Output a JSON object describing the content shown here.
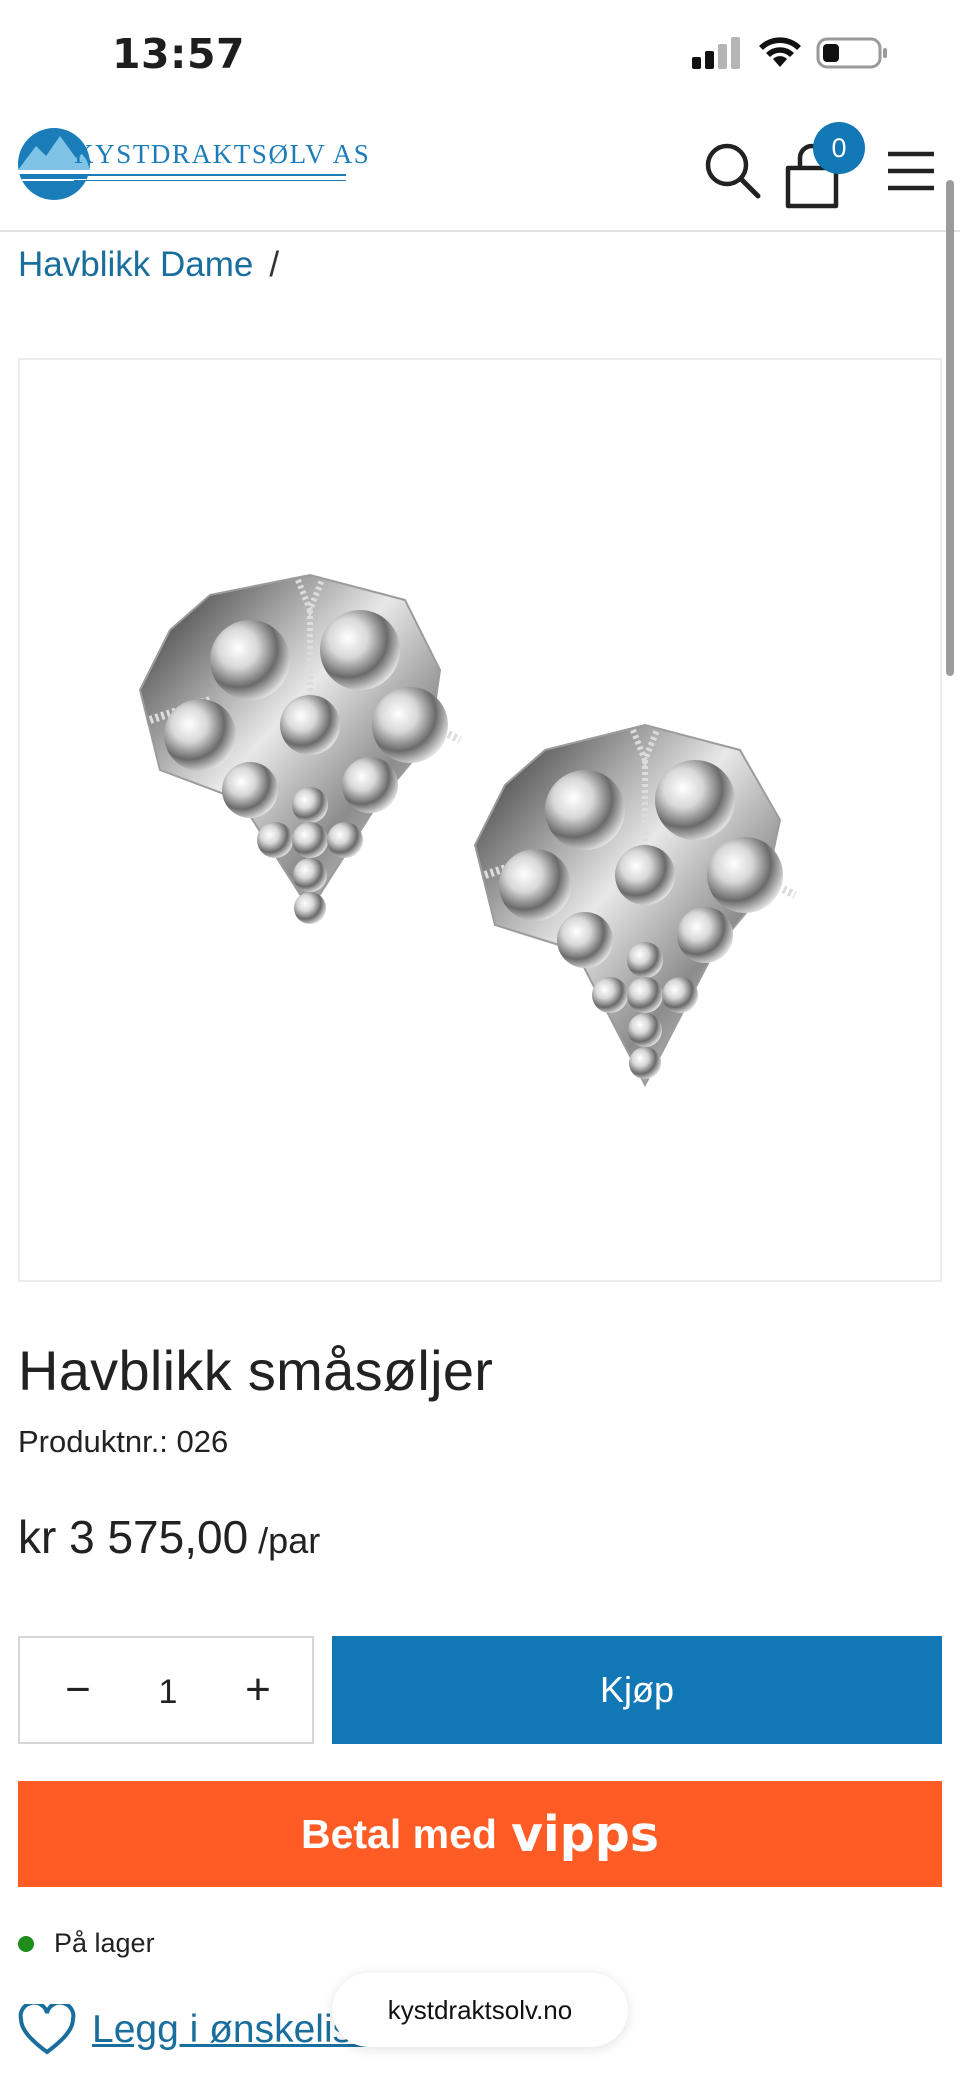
{
  "status_bar": {
    "time": "13:57"
  },
  "header": {
    "logo_text": "KYSTDRAKTSØLV AS",
    "cart_count": "0",
    "icons": [
      "search-icon",
      "cart-icon",
      "menu-icon"
    ],
    "accent_color": "#1277b5"
  },
  "breadcrumb": {
    "items": [
      "Havblikk Dame"
    ],
    "separator": "/"
  },
  "product": {
    "title": "Havblikk småsøljer",
    "number_label": "Produktnr.:",
    "number_value": "026",
    "price": "kr 3 575,00",
    "price_unit": "/par",
    "quantity": "1",
    "minus_label": "−",
    "plus_label": "+",
    "buy_label": "Kjøp",
    "vipps_label": "Betal med",
    "vipps_brand": "vipps",
    "stock_label": "På lager",
    "stock_color": "#1d8c1d",
    "wishlist_label": "Legg i ønskeliste"
  },
  "colors": {
    "buy_button": "#1277b5",
    "vipps_button": "#ff5b24",
    "link": "#1a6e9e"
  },
  "browser": {
    "url": "kystdraktsolv.no"
  }
}
